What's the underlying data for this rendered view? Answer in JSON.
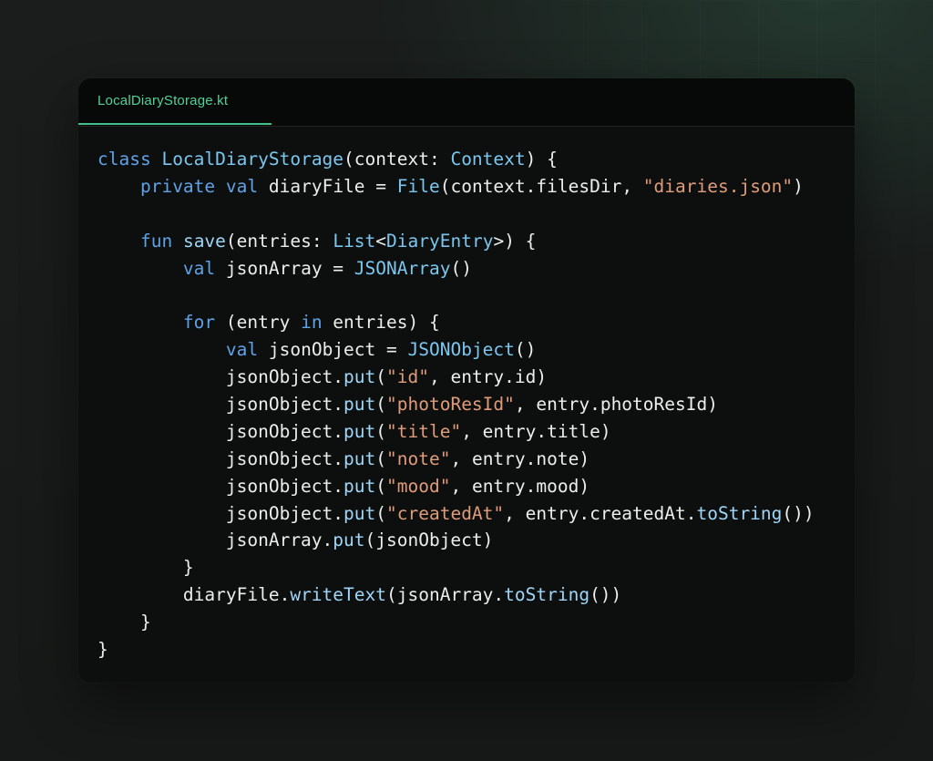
{
  "tab": {
    "label": "LocalDiaryStorage.kt"
  },
  "colors": {
    "background": "#181a19",
    "card": "#0d0e0e",
    "tab_accent": "#3fbf8a",
    "keyword": "#5fa2e6",
    "type": "#7cc7ef",
    "function": "#9fd6f8",
    "string": "#e09c7a",
    "plain": "#eceeed"
  },
  "code_lines": [
    [
      [
        "kw",
        "class"
      ],
      [
        "pl",
        " "
      ],
      [
        "ty",
        "LocalDiaryStorage"
      ],
      [
        "pl",
        "(context: "
      ],
      [
        "ty",
        "Context"
      ],
      [
        "pl",
        ") {"
      ]
    ],
    [
      [
        "pl",
        "    "
      ],
      [
        "kw",
        "private"
      ],
      [
        "pl",
        " "
      ],
      [
        "kw",
        "val"
      ],
      [
        "pl",
        " diaryFile = "
      ],
      [
        "ty",
        "File"
      ],
      [
        "pl",
        "(context.filesDir, "
      ],
      [
        "str",
        "\"diaries.json\""
      ],
      [
        "pl",
        ")"
      ]
    ],
    [],
    [
      [
        "pl",
        "    "
      ],
      [
        "kw",
        "fun"
      ],
      [
        "pl",
        " "
      ],
      [
        "fn",
        "save"
      ],
      [
        "pl",
        "(entries: "
      ],
      [
        "ty",
        "List"
      ],
      [
        "pl",
        "<"
      ],
      [
        "ty",
        "DiaryEntry"
      ],
      [
        "pl",
        ">) {"
      ]
    ],
    [
      [
        "pl",
        "        "
      ],
      [
        "kw",
        "val"
      ],
      [
        "pl",
        " jsonArray = "
      ],
      [
        "ty",
        "JSONArray"
      ],
      [
        "pl",
        "()"
      ]
    ],
    [],
    [
      [
        "pl",
        "        "
      ],
      [
        "kw",
        "for"
      ],
      [
        "pl",
        " (entry "
      ],
      [
        "kw",
        "in"
      ],
      [
        "pl",
        " entries) {"
      ]
    ],
    [
      [
        "pl",
        "            "
      ],
      [
        "kw",
        "val"
      ],
      [
        "pl",
        " jsonObject = "
      ],
      [
        "ty",
        "JSONObject"
      ],
      [
        "pl",
        "()"
      ]
    ],
    [
      [
        "pl",
        "            jsonObject."
      ],
      [
        "fn",
        "put"
      ],
      [
        "pl",
        "("
      ],
      [
        "str",
        "\"id\""
      ],
      [
        "pl",
        ", entry.id)"
      ]
    ],
    [
      [
        "pl",
        "            jsonObject."
      ],
      [
        "fn",
        "put"
      ],
      [
        "pl",
        "("
      ],
      [
        "str",
        "\"photoResId\""
      ],
      [
        "pl",
        ", entry.photoResId)"
      ]
    ],
    [
      [
        "pl",
        "            jsonObject."
      ],
      [
        "fn",
        "put"
      ],
      [
        "pl",
        "("
      ],
      [
        "str",
        "\"title\""
      ],
      [
        "pl",
        ", entry.title)"
      ]
    ],
    [
      [
        "pl",
        "            jsonObject."
      ],
      [
        "fn",
        "put"
      ],
      [
        "pl",
        "("
      ],
      [
        "str",
        "\"note\""
      ],
      [
        "pl",
        ", entry.note)"
      ]
    ],
    [
      [
        "pl",
        "            jsonObject."
      ],
      [
        "fn",
        "put"
      ],
      [
        "pl",
        "("
      ],
      [
        "str",
        "\"mood\""
      ],
      [
        "pl",
        ", entry.mood)"
      ]
    ],
    [
      [
        "pl",
        "            jsonObject."
      ],
      [
        "fn",
        "put"
      ],
      [
        "pl",
        "("
      ],
      [
        "str",
        "\"createdAt\""
      ],
      [
        "pl",
        ", entry.createdAt."
      ],
      [
        "fn",
        "toString"
      ],
      [
        "pl",
        "())"
      ]
    ],
    [
      [
        "pl",
        "            jsonArray."
      ],
      [
        "fn",
        "put"
      ],
      [
        "pl",
        "(jsonObject)"
      ]
    ],
    [
      [
        "pl",
        "        }"
      ]
    ],
    [
      [
        "pl",
        "        diaryFile."
      ],
      [
        "fn",
        "writeText"
      ],
      [
        "pl",
        "(jsonArray."
      ],
      [
        "fn",
        "toString"
      ],
      [
        "pl",
        "())"
      ]
    ],
    [
      [
        "pl",
        "    }"
      ]
    ],
    [
      [
        "pl",
        "}"
      ]
    ]
  ]
}
